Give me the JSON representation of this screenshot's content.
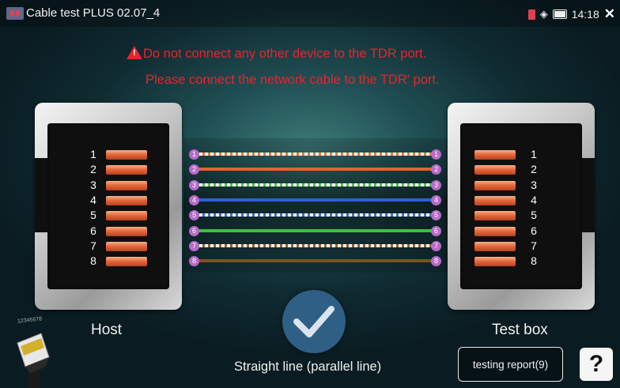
{
  "statusbar": {
    "title": "Cable test PLUS 02.07_4",
    "time": "14:18",
    "close_icon": "close-icon",
    "icons": [
      "sim-icon",
      "wifi-icon",
      "battery-icon"
    ]
  },
  "warnings": {
    "line1": "Do not connect any other device to the TDR port.",
    "line2": "Please connect the network cable to the TDR' port.",
    "icon": "warning-triangle-icon",
    "color": "#e8242e"
  },
  "host": {
    "label": "Host"
  },
  "test_box": {
    "label": "Test box"
  },
  "pins": [
    "1",
    "2",
    "3",
    "4",
    "5",
    "6",
    "7",
    "8"
  ],
  "wires": [
    {
      "pin": "1",
      "style": "striped",
      "color": "#e87a3a"
    },
    {
      "pin": "2",
      "style": "solid",
      "color": "#e8622a"
    },
    {
      "pin": "3",
      "style": "striped",
      "color": "#4fc24f"
    },
    {
      "pin": "4",
      "style": "solid",
      "color": "#2f5fd8"
    },
    {
      "pin": "5",
      "style": "striped",
      "color": "#3a6ee0"
    },
    {
      "pin": "6",
      "style": "solid",
      "color": "#3fbf3f"
    },
    {
      "pin": "7",
      "style": "striped",
      "color": "#a05a2a"
    },
    {
      "pin": "8",
      "style": "solid",
      "color": "#8a4a22"
    }
  ],
  "result": {
    "text": "Straight line (parallel line)",
    "icon": "checkmark-icon",
    "badge_color": "#2f5f85"
  },
  "buttons": {
    "report": "testing report(9)",
    "help": "?"
  },
  "plug_caption": "12345678"
}
